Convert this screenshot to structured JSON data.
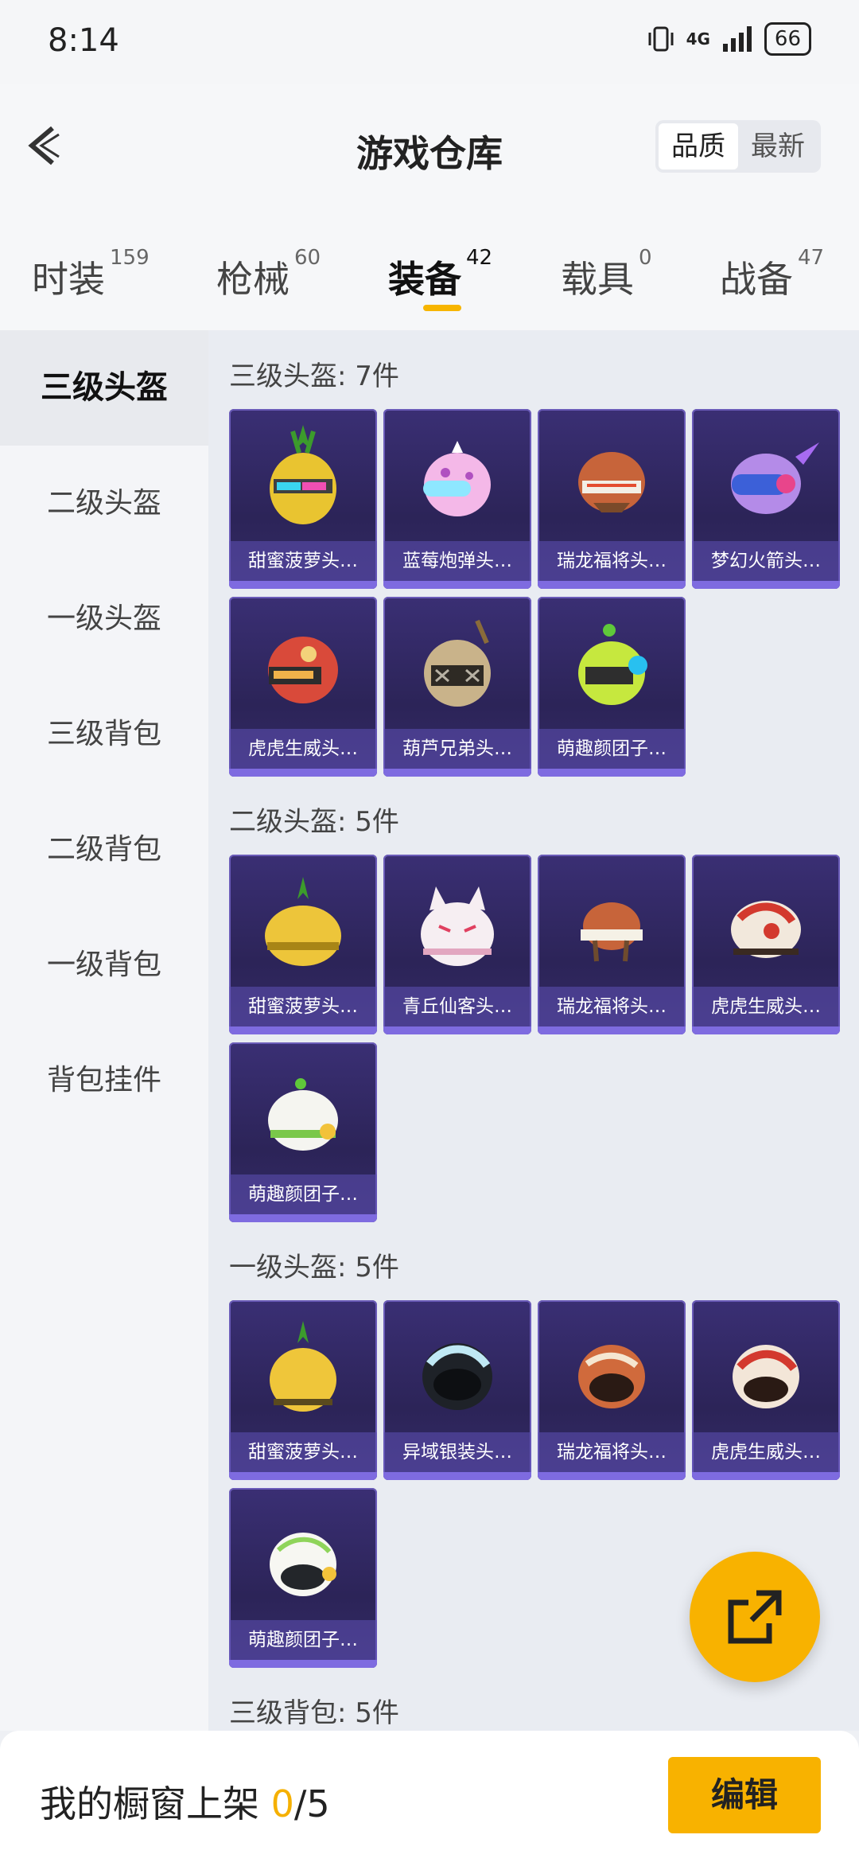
{
  "status_bar": {
    "time": "8:14",
    "network": "4G",
    "battery": "66"
  },
  "header": {
    "title": "游戏仓库",
    "sort_options": [
      "品质",
      "最新"
    ]
  },
  "tabs": [
    {
      "label": "时装",
      "count": "159"
    },
    {
      "label": "枪械",
      "count": "60"
    },
    {
      "label": "装备",
      "count": "42"
    },
    {
      "label": "载具",
      "count": "0"
    },
    {
      "label": "战备",
      "count": "47"
    }
  ],
  "sidebar": [
    "三级头盔",
    "二级头盔",
    "一级头盔",
    "三级背包",
    "二级背包",
    "一级背包",
    "背包挂件"
  ],
  "sections": [
    {
      "title": "三级头盔: 7件",
      "items": [
        "甜蜜菠萝头…",
        "蓝莓炮弹头…",
        "瑞龙福将头…",
        "梦幻火箭头…",
        "虎虎生威头…",
        "葫芦兄弟头…",
        "萌趣颜团子…"
      ]
    },
    {
      "title": "二级头盔: 5件",
      "items": [
        "甜蜜菠萝头…",
        "青丘仙客头…",
        "瑞龙福将头…",
        "虎虎生威头…",
        "萌趣颜团子…"
      ]
    },
    {
      "title": "一级头盔: 5件",
      "items": [
        "甜蜜菠萝头…",
        "异域银装头…",
        "瑞龙福将头…",
        "虎虎生威头…",
        "萌趣颜团子…"
      ]
    },
    {
      "title": "三级背包: 5件",
      "items": []
    }
  ],
  "bottom": {
    "shelf_label": "我的橱窗上架",
    "shelf_current": "0",
    "shelf_total": "/5",
    "edit_label": "编辑"
  },
  "colors": {
    "accent": "#f8b200",
    "card_bg": "#2f2660",
    "card_label": "#5f50b4"
  }
}
